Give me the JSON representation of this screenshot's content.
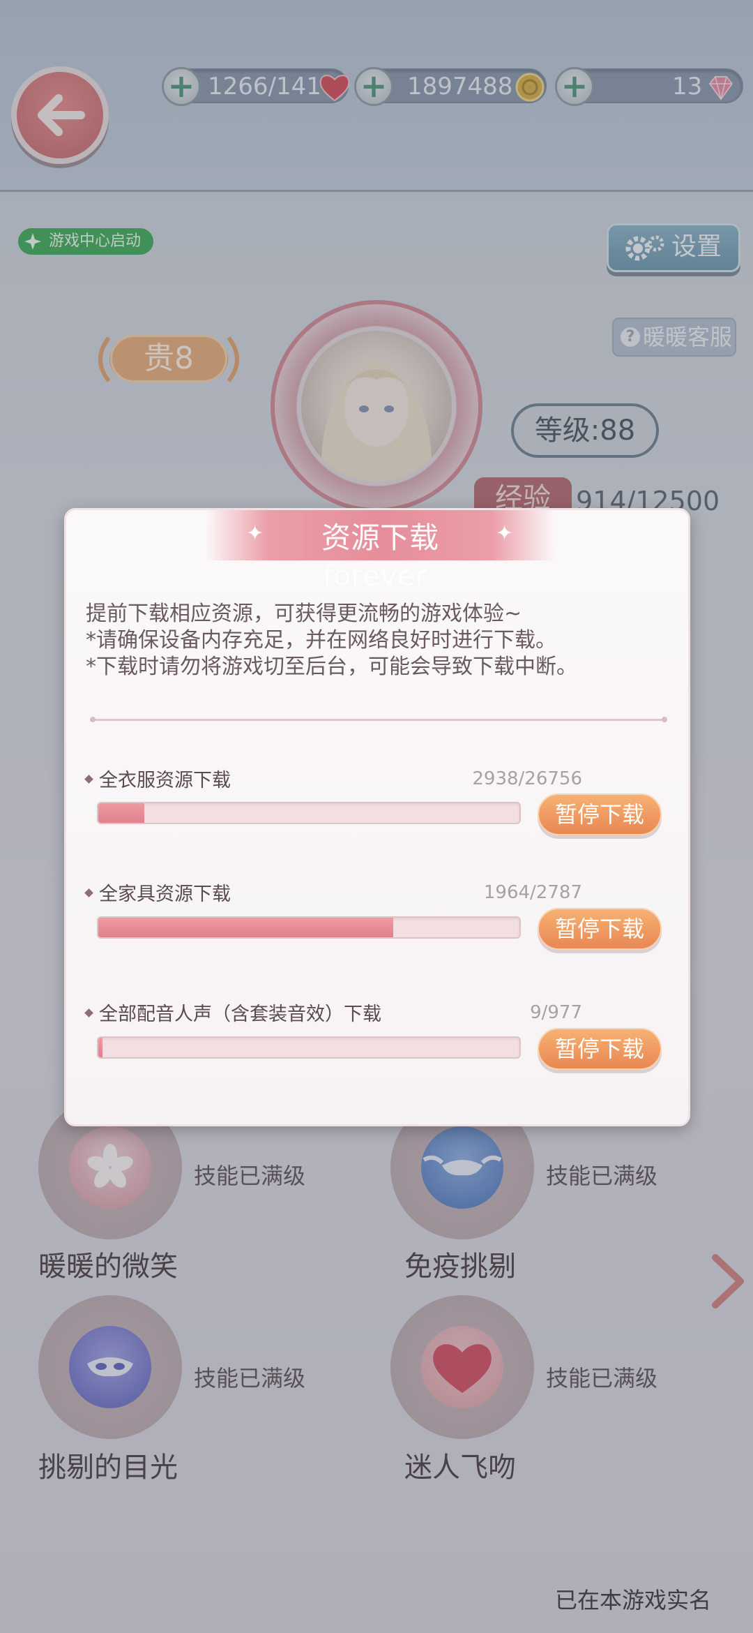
{
  "header": {
    "resources": [
      {
        "name": "stamina",
        "value": "1266/141",
        "icon": "heart-icon"
      },
      {
        "name": "gold",
        "value": "1897488",
        "icon": "coin-icon"
      },
      {
        "name": "diamond",
        "value": "13",
        "icon": "diamond-icon"
      }
    ]
  },
  "profile": {
    "game_center_badge": "游戏中心启动",
    "settings_label": "设置",
    "service_label": "暖暖客服",
    "vip_label": "贵8",
    "level_label": "等级:88",
    "exp_label": "经验",
    "exp_value": "914/12500"
  },
  "dialog": {
    "title": "资源下载",
    "ghost_text": "forever",
    "description": "提前下载相应资源，可获得更流畅的游戏体验~\n*请确保设备内存充足，并在网络良好时进行下载。\n*下载时请勿将游戏切至后台，可能会导致下载中断。",
    "items": [
      {
        "label": "全衣服资源下载",
        "count": "2938/26756",
        "progress": 0.11,
        "button": "暂停下载"
      },
      {
        "label": "全家具资源下载",
        "count": "1964/2787",
        "progress": 0.7,
        "button": "暂停下载"
      },
      {
        "label": "全部配音人声（含套装音效）下载",
        "count": "9/977",
        "progress": 0.01,
        "button": "暂停下载"
      }
    ]
  },
  "skills": [
    {
      "name": "暖暖的微笑",
      "status": "技能已满级",
      "icon": "sakura-icon"
    },
    {
      "name": "免疫挑剔",
      "status": "技能已满级",
      "icon": "winged-mask-icon"
    },
    {
      "name": "挑剔的目光",
      "status": "技能已满级",
      "icon": "mask-icon"
    },
    {
      "name": "迷人飞吻",
      "status": "技能已满级",
      "icon": "heart-icon"
    }
  ],
  "footer": {
    "realname": "已在本游戏实名"
  },
  "colors": {
    "accent_pink": "#e58e9a",
    "button_orange": "#e98753",
    "badge_green": "#3fae5a"
  }
}
